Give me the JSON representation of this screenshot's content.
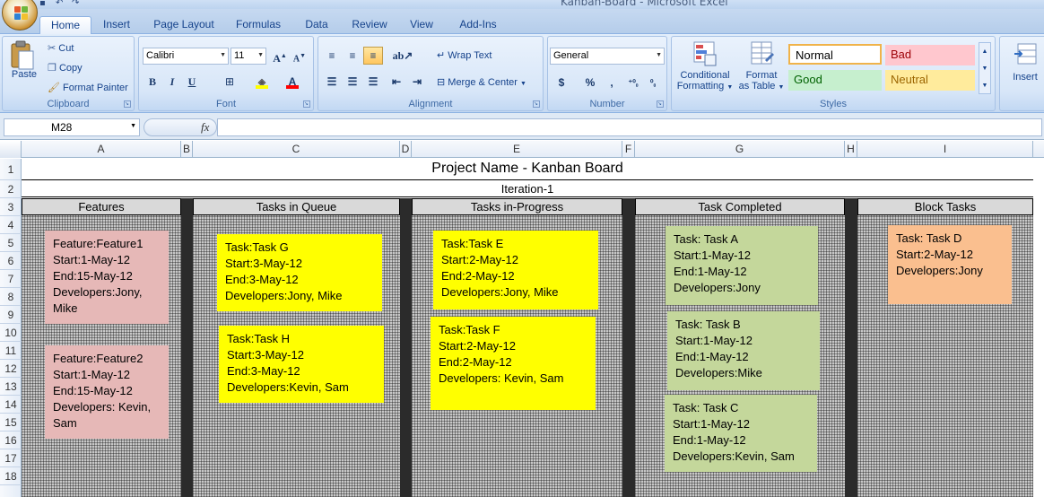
{
  "window": {
    "title": "Kanban-Board - Microsoft Excel"
  },
  "tabs": [
    "Home",
    "Insert",
    "Page Layout",
    "Formulas",
    "Data",
    "Review",
    "View",
    "Add-Ins"
  ],
  "ribbon": {
    "clipboard": {
      "label": "Clipboard",
      "paste": "Paste",
      "cut": "Cut",
      "copy": "Copy",
      "format_painter": "Format Painter"
    },
    "font": {
      "label": "Font",
      "family": "Calibri",
      "size": "11",
      "bold": "B",
      "italic": "I",
      "underline": "U",
      "grow": "A",
      "shrink": "A"
    },
    "alignment": {
      "label": "Alignment",
      "wrap_text": "Wrap Text",
      "merge_center": "Merge & Center"
    },
    "number": {
      "label": "Number",
      "format": "General",
      "currency": "$",
      "percent": "%",
      "comma": ",",
      "inc_decimal": "⁺⁰₀",
      "dec_decimal": "⁰₀"
    },
    "styles": {
      "label": "Styles",
      "conditional": "Conditional",
      "conditional2": "Formatting",
      "format_as": "Format",
      "format_as2": "as Table",
      "normal": "Normal",
      "bad": "Bad",
      "good": "Good",
      "neutral": "Neutral"
    },
    "cells": {
      "insert": "Insert"
    }
  },
  "formula_bar": {
    "name_box": "M28",
    "fx": "fx",
    "content": ""
  },
  "columns": [
    "A",
    "B",
    "C",
    "D",
    "E",
    "F",
    "G",
    "H",
    "I"
  ],
  "rows": [
    "1",
    "2",
    "3",
    "4",
    "5",
    "6",
    "7",
    "8",
    "9",
    "10",
    "11",
    "12",
    "13",
    "14",
    "15",
    "16",
    "17",
    "18"
  ],
  "sheet": {
    "title": "Project Name - Kanban Board",
    "iteration": "Iteration-1",
    "headers": [
      "Features",
      "Tasks in Queue",
      "Tasks in-Progress",
      "Task Completed",
      "Block Tasks"
    ]
  },
  "cards": {
    "feature1": [
      "Feature:Feature1",
      "Start:1-May-12",
      "End:15-May-12",
      "Developers:Jony,",
      "Mike"
    ],
    "feature2": [
      "Feature:Feature2",
      "Start:1-May-12",
      "End:15-May-12",
      "Developers:  Kevin,",
      "Sam"
    ],
    "taskG": [
      "Task:Task G",
      "Start:3-May-12",
      "End:3-May-12",
      "Developers:Jony, Mike"
    ],
    "taskH": [
      "Task:Task H",
      "Start:3-May-12",
      "End:3-May-12",
      "Developers:Kevin, Sam"
    ],
    "taskE": [
      "Task:Task E",
      "Start:2-May-12",
      "End:2-May-12",
      "Developers:Jony, Mike"
    ],
    "taskF": [
      "Task:Task F",
      "Start:2-May-12",
      "End:2-May-12",
      "Developers: Kevin, Sam"
    ],
    "taskA": [
      "Task: Task A",
      "Start:1-May-12",
      "End:1-May-12",
      "Developers:Jony"
    ],
    "taskB": [
      "Task: Task B",
      "Start:1-May-12",
      "End:1-May-12",
      "Developers:Mike"
    ],
    "taskC": [
      "Task: Task C",
      "Start:1-May-12",
      "End:1-May-12",
      "Developers:Kevin, Sam"
    ],
    "taskD": [
      "Task: Task D",
      "Start:2-May-12",
      "Developers:Jony"
    ]
  }
}
